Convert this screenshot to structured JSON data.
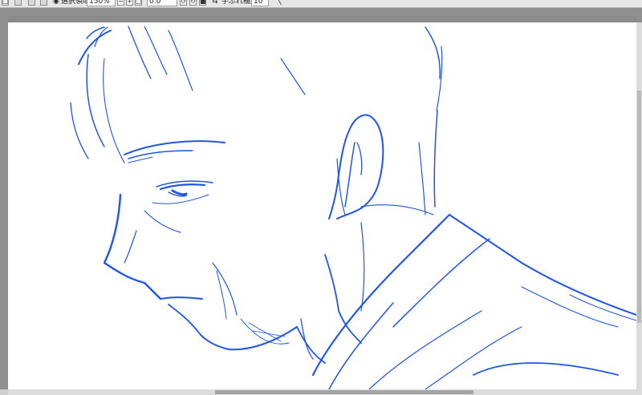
{
  "toolbar": {
    "select_mode_label": "選択領域",
    "zoom_value": "150%",
    "rotation_value": "0.0°",
    "stabilization_label": "手ぶれ補正",
    "stabilization_value": "10"
  },
  "canvas": {
    "line_color": "#1f55e8",
    "subject": "line-art"
  }
}
